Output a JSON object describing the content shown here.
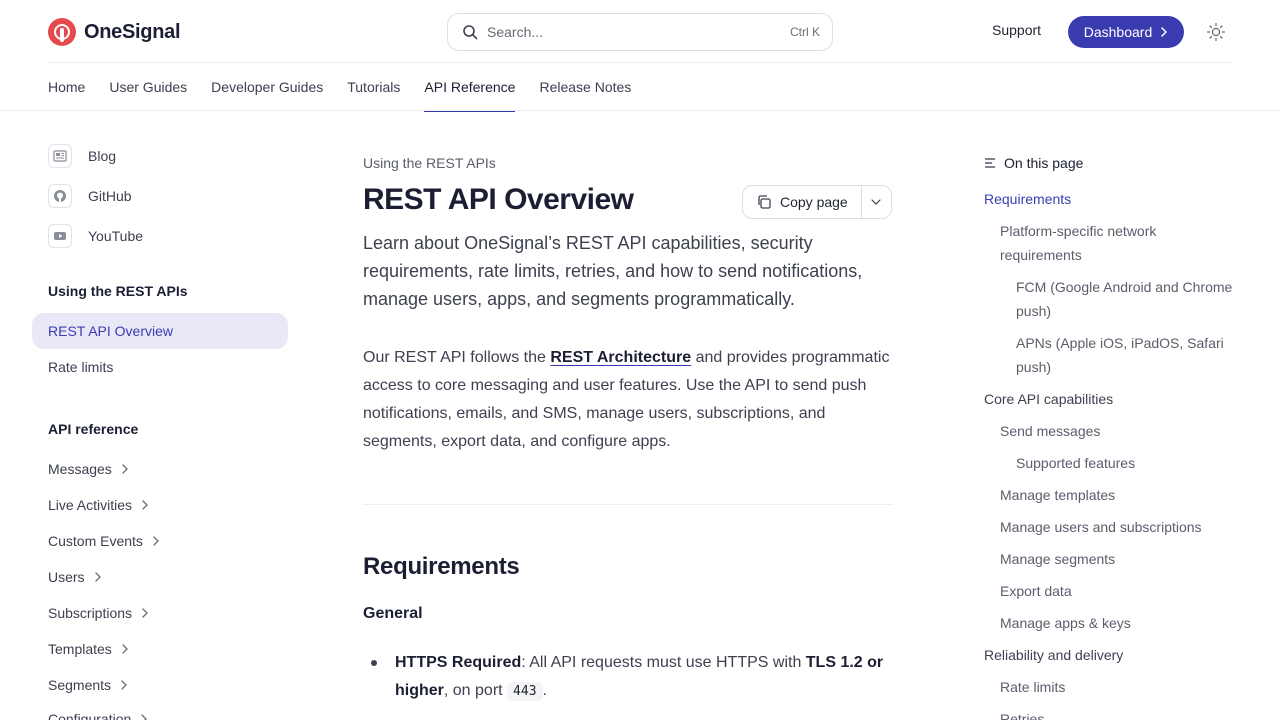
{
  "header": {
    "logo_text": "OneSignal",
    "search_placeholder": "Search...",
    "search_shortcut": "Ctrl K",
    "support_label": "Support",
    "dashboard_label": "Dashboard",
    "brand_color": "#3b3bb0",
    "logo_color": "#e54b4d"
  },
  "tabs": [
    {
      "label": "Home"
    },
    {
      "label": "User Guides"
    },
    {
      "label": "Developer Guides"
    },
    {
      "label": "Tutorials"
    },
    {
      "label": "API Reference",
      "active": true
    },
    {
      "label": "Release Notes"
    }
  ],
  "sidebar": {
    "external_links": [
      {
        "label": "Blog",
        "icon": "newspaper-icon"
      },
      {
        "label": "GitHub",
        "icon": "github-icon"
      },
      {
        "label": "YouTube",
        "icon": "youtube-icon"
      }
    ],
    "section1_heading": "Using the REST APIs",
    "section1_items": [
      {
        "label": "REST API Overview",
        "active": true
      },
      {
        "label": "Rate limits"
      }
    ],
    "section2_heading": "API reference",
    "section2_items": [
      {
        "label": "Messages"
      },
      {
        "label": "Live Activities"
      },
      {
        "label": "Custom Events"
      },
      {
        "label": "Users"
      },
      {
        "label": "Subscriptions"
      },
      {
        "label": "Templates"
      },
      {
        "label": "Segments"
      },
      {
        "label": "Configuration"
      }
    ]
  },
  "main": {
    "breadcrumb": "Using the REST APIs",
    "title": "REST API Overview",
    "copy_page_label": "Copy page",
    "lead": "Learn about OneSignal’s REST API capabilities, security requirements, rate limits, retries, and how to send notifications, manage users, apps, and segments programmatically.",
    "para_before_link": "Our REST API follows the ",
    "para_link": "REST Architecture",
    "para_after_link": " and provides programmatic access to core messaging and user features. Use the API to send push notifications, emails, and SMS, manage users, subscriptions, and segments, export data, and configure apps.",
    "h2_requirements": "Requirements",
    "h3_general": "General",
    "bullet_https_bold": "HTTPS Required",
    "bullet_https_text": ": All API requests must use HTTPS with ",
    "bullet_tls_bold": "TLS 1.2 or higher",
    "bullet_port_text": ", on port ",
    "bullet_port_code": "443",
    "bullet_end": "."
  },
  "toc": {
    "heading": "On this page",
    "items": [
      {
        "label": "Requirements",
        "level": 1,
        "active": true
      },
      {
        "label": "Platform-specific network requirements",
        "level": 2
      },
      {
        "label": "FCM (Google Android and Chrome push)",
        "level": 3
      },
      {
        "label": "APNs (Apple iOS, iPadOS, Safari push)",
        "level": 3
      },
      {
        "label": "Core API capabilities",
        "level": 1
      },
      {
        "label": "Send messages",
        "level": 2
      },
      {
        "label": "Supported features",
        "level": 3
      },
      {
        "label": "Manage templates",
        "level": 2
      },
      {
        "label": "Manage users and subscriptions",
        "level": 2
      },
      {
        "label": "Manage segments",
        "level": 2
      },
      {
        "label": "Export data",
        "level": 2
      },
      {
        "label": "Manage apps & keys",
        "level": 2
      },
      {
        "label": "Reliability and delivery",
        "level": 1
      },
      {
        "label": "Rate limits",
        "level": 2
      },
      {
        "label": "Retries",
        "level": 2
      }
    ]
  }
}
